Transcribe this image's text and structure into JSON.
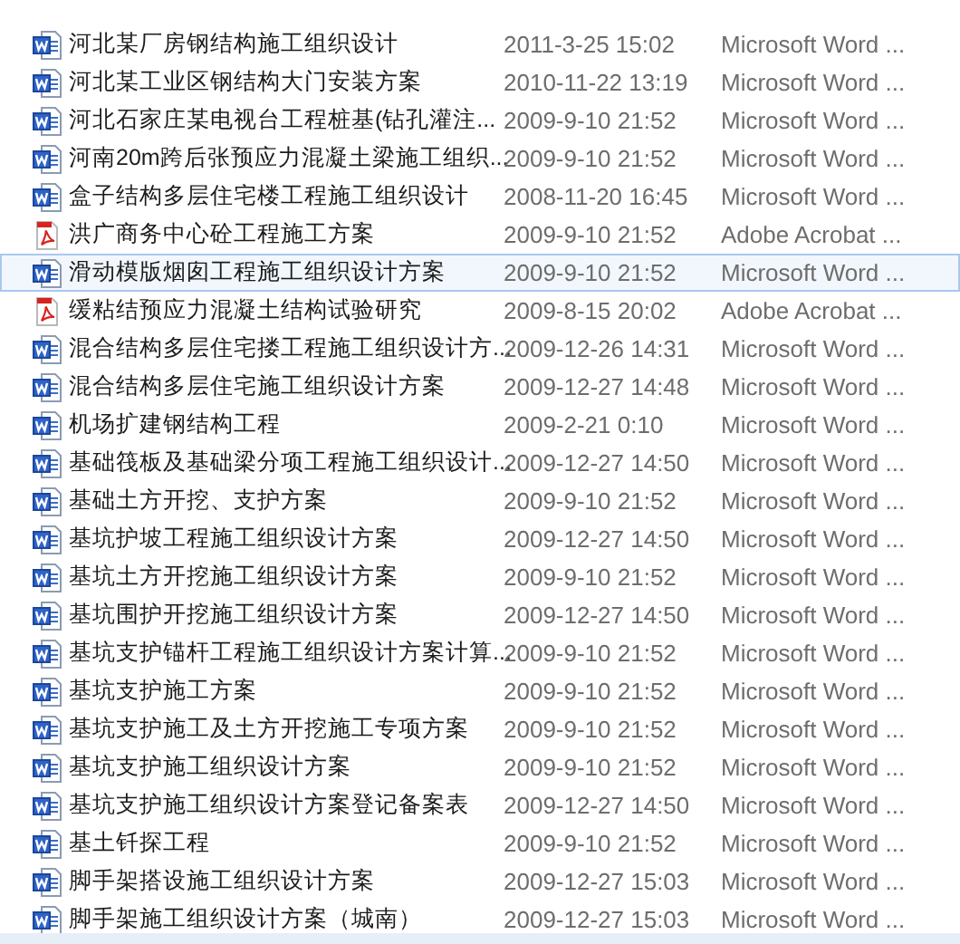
{
  "files": [
    {
      "name": "河北某厂房钢结构施工组织设计",
      "date": "2011-3-25 15:02",
      "type": "Microsoft Word ...",
      "kind": "word",
      "selected": false
    },
    {
      "name": "河北某工业区钢结构大门安装方案",
      "date": "2010-11-22 13:19",
      "type": "Microsoft Word ...",
      "kind": "word",
      "selected": false
    },
    {
      "name": "河北石家庄某电视台工程桩基(钻孔灌注...",
      "date": "2009-9-10 21:52",
      "type": "Microsoft Word ...",
      "kind": "word",
      "selected": false
    },
    {
      "name": "河南20m跨后张预应力混凝土梁施工组织...",
      "date": "2009-9-10 21:52",
      "type": "Microsoft Word ...",
      "kind": "word",
      "selected": false
    },
    {
      "name": "盒子结构多层住宅楼工程施工组织设计",
      "date": "2008-11-20 16:45",
      "type": "Microsoft Word ...",
      "kind": "word",
      "selected": false
    },
    {
      "name": "洪广商务中心砼工程施工方案",
      "date": "2009-9-10 21:52",
      "type": "Adobe Acrobat ...",
      "kind": "pdf",
      "selected": false
    },
    {
      "name": "滑动模版烟囱工程施工组织设计方案",
      "date": "2009-9-10 21:52",
      "type": "Microsoft Word ...",
      "kind": "word",
      "selected": true
    },
    {
      "name": "缓粘结预应力混凝土结构试验研究",
      "date": "2009-8-15 20:02",
      "type": "Adobe Acrobat ...",
      "kind": "pdf",
      "selected": false
    },
    {
      "name": "混合结构多层住宅搂工程施工组织设计方...",
      "date": "2009-12-26 14:31",
      "type": "Microsoft Word ...",
      "kind": "word",
      "selected": false
    },
    {
      "name": "混合结构多层住宅施工组织设计方案",
      "date": "2009-12-27 14:48",
      "type": "Microsoft Word ...",
      "kind": "word",
      "selected": false
    },
    {
      "name": "机场扩建钢结构工程",
      "date": "2009-2-21 0:10",
      "type": "Microsoft Word ...",
      "kind": "word",
      "selected": false
    },
    {
      "name": "基础筏板及基础梁分项工程施工组织设计...",
      "date": "2009-12-27 14:50",
      "type": "Microsoft Word ...",
      "kind": "word",
      "selected": false
    },
    {
      "name": "基础土方开挖、支护方案",
      "date": "2009-9-10 21:52",
      "type": "Microsoft Word ...",
      "kind": "word",
      "selected": false
    },
    {
      "name": "基坑护坡工程施工组织设计方案",
      "date": "2009-12-27 14:50",
      "type": "Microsoft Word ...",
      "kind": "word",
      "selected": false
    },
    {
      "name": "基坑土方开挖施工组织设计方案",
      "date": "2009-9-10 21:52",
      "type": "Microsoft Word ...",
      "kind": "word",
      "selected": false
    },
    {
      "name": "基坑围护开挖施工组织设计方案",
      "date": "2009-12-27 14:50",
      "type": "Microsoft Word ...",
      "kind": "word",
      "selected": false
    },
    {
      "name": "基坑支护锚杆工程施工组织设计方案计算...",
      "date": "2009-9-10 21:52",
      "type": "Microsoft Word ...",
      "kind": "word",
      "selected": false
    },
    {
      "name": "基坑支护施工方案",
      "date": "2009-9-10 21:52",
      "type": "Microsoft Word ...",
      "kind": "word",
      "selected": false
    },
    {
      "name": "基坑支护施工及土方开挖施工专项方案",
      "date": "2009-9-10 21:52",
      "type": "Microsoft Word ...",
      "kind": "word",
      "selected": false
    },
    {
      "name": "基坑支护施工组织设计方案",
      "date": "2009-9-10 21:52",
      "type": "Microsoft Word ...",
      "kind": "word",
      "selected": false
    },
    {
      "name": "基坑支护施工组织设计方案登记备案表",
      "date": "2009-12-27 14:50",
      "type": "Microsoft Word ...",
      "kind": "word",
      "selected": false
    },
    {
      "name": "基土钎探工程",
      "date": "2009-9-10 21:52",
      "type": "Microsoft Word ...",
      "kind": "word",
      "selected": false
    },
    {
      "name": "脚手架搭设施工组织设计方案",
      "date": "2009-12-27 15:03",
      "type": "Microsoft Word ...",
      "kind": "word",
      "selected": false
    },
    {
      "name": "脚手架施工组织设计方案（城南）",
      "date": "2009-12-27 15:03",
      "type": "Microsoft Word ...",
      "kind": "word",
      "selected": false
    }
  ]
}
